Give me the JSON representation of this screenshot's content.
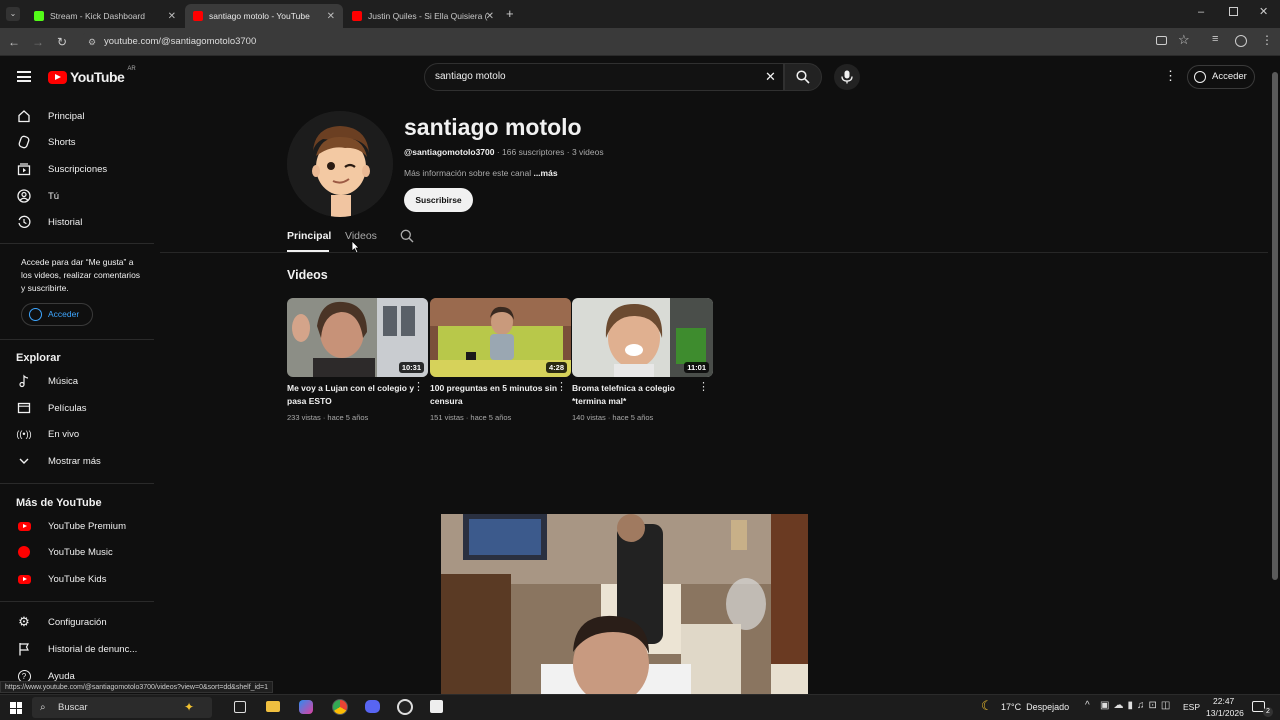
{
  "browser": {
    "tabs": [
      {
        "title": "Stream - Kick Dashboard",
        "favicon_color": "#53fc18"
      },
      {
        "title": "santiago motolo - YouTube",
        "favicon_color": "#ff0000"
      },
      {
        "title": "Justin Quiles - Si Ella Quisiera (",
        "favicon_color": "#ff0000"
      }
    ],
    "new_tab": "+",
    "url": "youtube.com/@santiagomotolo3700",
    "status_url": "https://www.youtube.com/@santiagomotolo3700/videos?view=0&sort=dd&shelf_id=1"
  },
  "header": {
    "logo_text": "YouTube",
    "logo_region": "AR",
    "search_value": "santiago motolo",
    "signin_label": "Acceder"
  },
  "sidebar": {
    "main": [
      {
        "label": "Principal",
        "icon": "home-icon"
      },
      {
        "label": "Shorts",
        "icon": "shorts-icon"
      },
      {
        "label": "Suscripciones",
        "icon": "subscriptions-icon"
      },
      {
        "label": "Tú",
        "icon": "user-icon"
      },
      {
        "label": "Historial",
        "icon": "history-icon"
      }
    ],
    "signin_prompt": "Accede para dar “Me gusta” a los videos, realizar comentarios y suscribirte.",
    "signin_button": "Acceder",
    "explore_title": "Explorar",
    "explore": [
      {
        "label": "Música",
        "icon": "music-icon"
      },
      {
        "label": "Películas",
        "icon": "movies-icon"
      },
      {
        "label": "En vivo",
        "icon": "live-icon"
      },
      {
        "label": "Mostrar más",
        "icon": "chevron-down-icon"
      }
    ],
    "more_title": "Más de YouTube",
    "more": [
      {
        "label": "YouTube Premium"
      },
      {
        "label": "YouTube Music"
      },
      {
        "label": "YouTube Kids"
      }
    ],
    "settings": [
      {
        "label": "Configuración",
        "icon": "gear-icon"
      },
      {
        "label": "Historial de denunc...",
        "icon": "flag-icon"
      },
      {
        "label": "Ayuda",
        "icon": "help-icon"
      }
    ]
  },
  "channel": {
    "name": "santiago motolo",
    "handle": "@santiagomotolo3700",
    "stats": " · 166 suscriptores · 3 videos",
    "more_info": "Más información sobre este canal ",
    "more_link": "...más",
    "subscribe": "Suscribirse",
    "tabs": [
      "Principal",
      "Videos"
    ],
    "section_title": "Videos"
  },
  "videos": [
    {
      "title": "Me voy a Lujan con el colegio y pasa ESTO",
      "duration": "10:31",
      "meta": "233 vistas · hace 5 años"
    },
    {
      "title": "100 preguntas en 5 minutos sin censura",
      "duration": "4:28",
      "meta": "151 vistas · hace 5 años"
    },
    {
      "title": "Broma telefnica a colegio *termina mal*",
      "duration": "11:01",
      "meta": "140 vistas · hace 5 años"
    }
  ],
  "taskbar": {
    "search_placeholder": "Buscar",
    "weather": "17°C  Despejado",
    "lang": "ESP",
    "time": "22:47",
    "date": "13/1/2026",
    "notifications": "2"
  }
}
